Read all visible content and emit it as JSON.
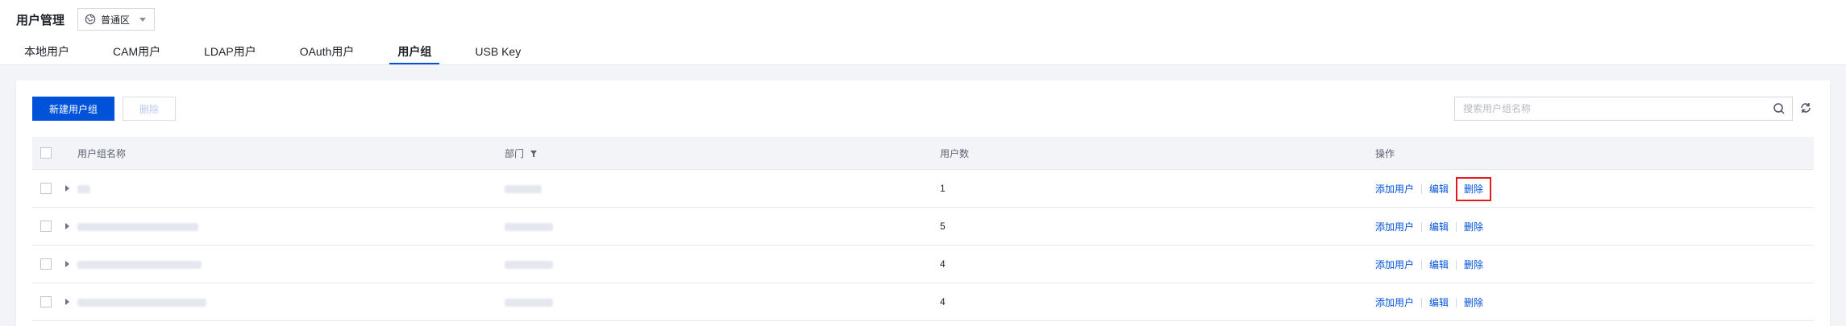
{
  "header": {
    "title": "用户管理",
    "region": "普通区"
  },
  "tabs": [
    {
      "label": "本地用户",
      "active": false
    },
    {
      "label": "CAM用户",
      "active": false
    },
    {
      "label": "LDAP用户",
      "active": false
    },
    {
      "label": "OAuth用户",
      "active": false
    },
    {
      "label": "用户组",
      "active": true
    },
    {
      "label": "USB Key",
      "active": false
    }
  ],
  "toolbar": {
    "new_label": "新建用户组",
    "delete_label": "删除",
    "search_placeholder": "搜索用户组名称"
  },
  "table": {
    "headers": {
      "name": "用户组名称",
      "dept": "部门",
      "count": "用户数",
      "ops": "操作"
    },
    "rows": [
      {
        "count": "1"
      },
      {
        "count": "5"
      },
      {
        "count": "4"
      },
      {
        "count": "4"
      }
    ],
    "row_actions": {
      "add_user": "添加用户",
      "edit": "编辑",
      "delete": "删除"
    }
  },
  "colors": {
    "accent": "#0052d9",
    "highlight": "#e31d1d"
  }
}
